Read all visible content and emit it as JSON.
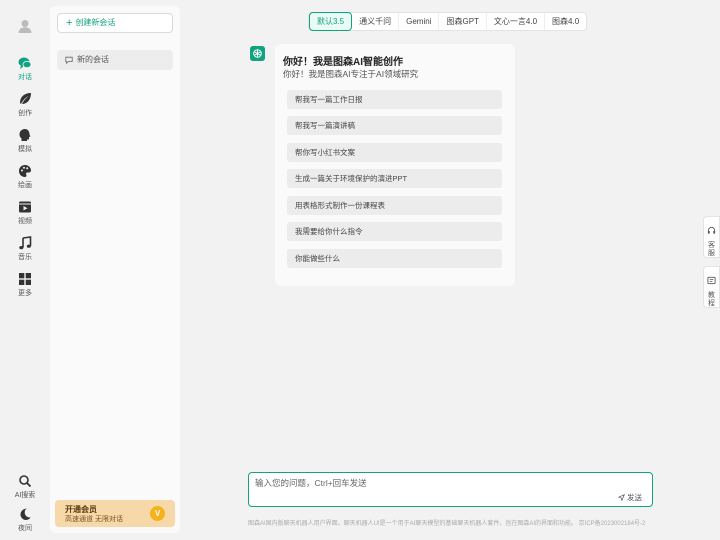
{
  "rail": {
    "items": [
      {
        "label": "对话",
        "icon": "chat-icon",
        "active": true
      },
      {
        "label": "创作",
        "icon": "feather-icon",
        "active": false
      },
      {
        "label": "模拟",
        "icon": "head-icon",
        "active": false
      },
      {
        "label": "绘画",
        "icon": "palette-icon",
        "active": false
      },
      {
        "label": "视频",
        "icon": "video-icon",
        "active": false
      },
      {
        "label": "音乐",
        "icon": "music-icon",
        "active": false
      },
      {
        "label": "更多",
        "icon": "grid-icon",
        "active": false
      }
    ],
    "bottom": [
      {
        "label": "AI搜索",
        "icon": "search-icon"
      },
      {
        "label": "夜间",
        "icon": "moon-icon"
      }
    ]
  },
  "panel": {
    "new_chat_label": "创建新会话",
    "conversations": [
      {
        "label": "新的会话"
      }
    ],
    "vip": {
      "title": "开通会员",
      "subtitle": "高速通道 无限对话",
      "badge": "V"
    }
  },
  "tabs": [
    {
      "label": "默认3.5",
      "active": true
    },
    {
      "label": "通义千问",
      "active": false
    },
    {
      "label": "Gemini",
      "active": false
    },
    {
      "label": "图森GPT",
      "active": false
    },
    {
      "label": "文心一言4.0",
      "active": false
    },
    {
      "label": "图森4.0",
      "active": false
    }
  ],
  "welcome": {
    "title": "你好！我是图森AI智能创作",
    "subtitle": "你好！我是图森AI专注于AI领域研究",
    "prompts": [
      "帮我写一篇工作日报",
      "帮我写一篇演讲稿",
      "帮你写小红书文案",
      "生成一篇关于环境保护的演进PPT",
      "用表格形式制作一份课程表",
      "我需要给你什么指令",
      "你能做些什么"
    ]
  },
  "floats": [
    {
      "label": "客服",
      "icon": "headset-icon"
    },
    {
      "label": "教程",
      "icon": "book-icon"
    }
  ],
  "input": {
    "placeholder": "输入您的问题，Ctrl+回车发送",
    "send_label": "发送"
  },
  "footer": "图森AI国内版聊天机器人用户界面。聊天机器人UI是一个用于AI聊天模型的基础聊天机器人套件。旨在图森AI的界面和功能。    京ICP备2023002184号-2",
  "colors": {
    "accent": "#10a37f",
    "vip_bg": "#f6d8a9",
    "vip_badge": "#f5b21a"
  }
}
